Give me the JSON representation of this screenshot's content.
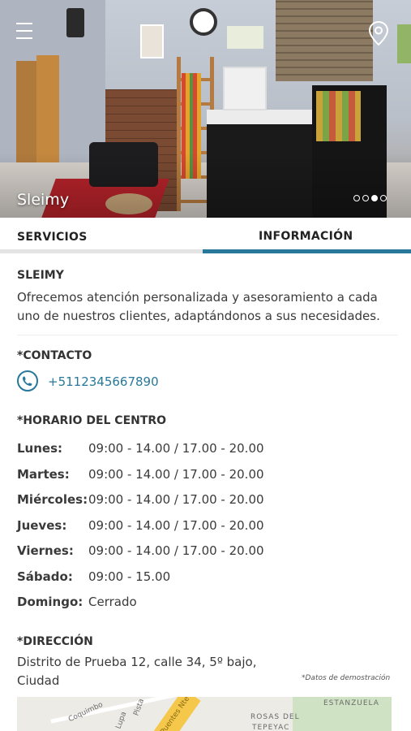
{
  "hero": {
    "title": "Sleimy",
    "slide_count": 4,
    "active_slide": 3
  },
  "tabs": [
    {
      "label": "SERVICIOS",
      "active": false
    },
    {
      "label": "INFORMACIÓN",
      "active": true
    }
  ],
  "about": {
    "heading": "SLEIMY",
    "text": "Ofrecemos atención personalizada y asesoramiento a cada uno de nuestros clientes, adaptándonos a sus necesidades."
  },
  "contact": {
    "heading": "*CONTACTO",
    "phone": "+5112345667890"
  },
  "schedule": {
    "heading": "*HORARIO DEL CENTRO",
    "rows": [
      {
        "day": "Lunes:",
        "hours": "09:00 - 14.00  /  17.00 - 20.00"
      },
      {
        "day": "Martes:",
        "hours": "09:00 - 14.00  /  17.00 - 20.00"
      },
      {
        "day": "Miércoles:",
        "hours": "09:00 - 14.00  /  17.00 - 20.00"
      },
      {
        "day": "Jueves:",
        "hours": "09:00 - 14.00  /  17.00 - 20.00"
      },
      {
        "day": "Viernes:",
        "hours": "09:00 - 14.00  /  17.00 - 20.00"
      },
      {
        "day": "Sábado:",
        "hours": "09:00 - 15.00"
      },
      {
        "day": "Domingo:",
        "hours": "Cerrado"
      }
    ]
  },
  "address": {
    "heading": "*DIRECCIÓN",
    "line1": "Distrito de Prueba 12, calle 34, 5º bajo,",
    "line2": "Ciudad",
    "note": "*Datos de demostración"
  },
  "map": {
    "labels": [
      "Coquimbo",
      "Lupa",
      "Pista",
      "Puentes Nte",
      "ROSAS DEL",
      "TEPEYAC",
      "ESTANZUELA"
    ]
  },
  "colors": {
    "accent": "#27789a",
    "tab_inactive_line": "#e4e4e4"
  },
  "icons": [
    "menu-icon",
    "map-pin-icon",
    "phone-icon"
  ]
}
